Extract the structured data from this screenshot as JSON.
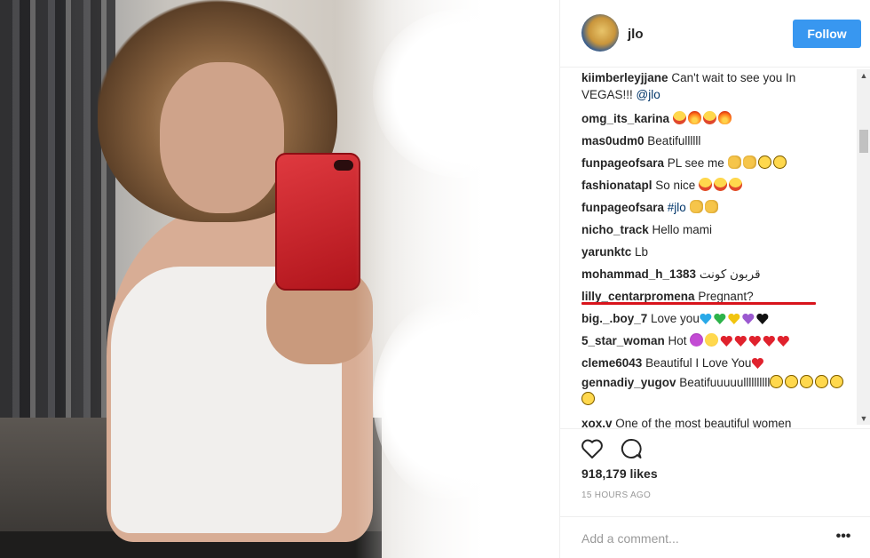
{
  "header": {
    "username": "jlo",
    "follow_label": "Follow"
  },
  "comments": [
    {
      "user": "kiimberleyjjane",
      "text": " Can't wait to see you In VEGAS!!! ",
      "mention": "@jlo",
      "emoji": []
    },
    {
      "user": "omg_its_karina",
      "text": " ",
      "emoji": [
        "heart-eyes",
        "fire",
        "heart-eyes",
        "fire"
      ]
    },
    {
      "user": "mas0udm0",
      "text": " Beatifullllll",
      "emoji": []
    },
    {
      "user": "funpageofsara",
      "text": " PL see me ",
      "emoji": [
        "clap",
        "clap",
        "persevere",
        "persevere"
      ]
    },
    {
      "user": "fashionatapl",
      "text": " So nice ",
      "emoji": [
        "heart-eyes",
        "heart-eyes",
        "heart-eyes"
      ]
    },
    {
      "user": "funpageofsara",
      "text": " ",
      "mention": "#jlo",
      "emoji": [
        "clap",
        "clap"
      ]
    },
    {
      "user": "nicho_track",
      "text": " Hello mami",
      "emoji": []
    },
    {
      "user": "yarunktc",
      "text": " Lb",
      "emoji": []
    },
    {
      "user": "mohammad_h_1383",
      "text": " قربون کونت",
      "emoji": []
    },
    {
      "user": "lilly_centarpromena",
      "text": " Pregnant?",
      "emoji": []
    },
    {
      "user": "big._.boy_7",
      "text": " Love you",
      "emoji": [
        "blue-heart",
        "green-heart",
        "yellow-heart",
        "purple-heart",
        "black-heart"
      ]
    },
    {
      "user": "5_star_woman",
      "text": " Hot ",
      "emoji": [
        "devil",
        "smile",
        "red-heart",
        "red-heart",
        "red-heart",
        "red-heart",
        "red-heart"
      ]
    },
    {
      "user": "cleme6043",
      "text": " Beautiful I Love You",
      "emoji": [
        "red-heart"
      ]
    },
    {
      "user": "gennadiy_yugov",
      "text": " Beatifuuuuullllllllll",
      "emoji": [
        "persevere",
        "persevere",
        "persevere",
        "persevere",
        "persevere",
        "persevere"
      ]
    },
    {
      "user": "xox.v",
      "text": " One of the most beautiful women",
      "emoji": []
    }
  ],
  "actions": {
    "like_icon": "heart-outline-icon",
    "comment_icon": "speech-bubble-icon",
    "likes": "918,179 likes",
    "time": "15 HOURS AGO"
  },
  "add_comment": {
    "placeholder": "Add a comment...",
    "more": "•••"
  },
  "colors": {
    "follow_bg": "#3897f0",
    "mention": "#003569",
    "underline": "#d8141c"
  }
}
